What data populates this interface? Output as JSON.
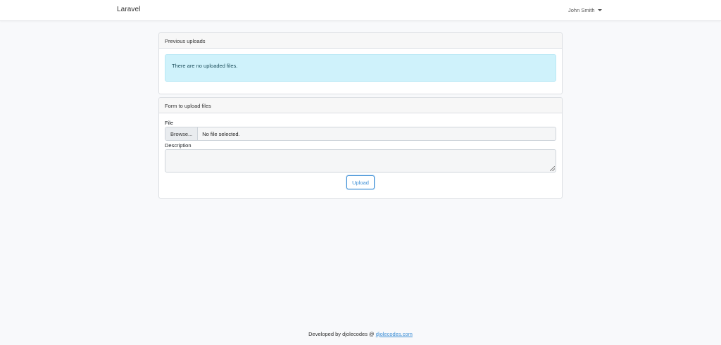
{
  "navbar": {
    "brand": "Laravel",
    "user_name": "John Smith"
  },
  "previous_uploads": {
    "title": "Previous uploads",
    "empty_message": "There are no uploaded files."
  },
  "upload_form": {
    "title": "Form to upload files",
    "file_label": "File",
    "browse_label": "Browse...",
    "file_status": "No file selected.",
    "description_label": "Description",
    "description_value": "",
    "submit_label": "Upload"
  },
  "footer": {
    "text": "Developed by djolecodes @ ",
    "link_text": "djolecodes.com"
  },
  "colors": {
    "accent": "#3d8fd6",
    "info_bg": "#cff2fb",
    "page_bg": "#f8f9fb"
  }
}
